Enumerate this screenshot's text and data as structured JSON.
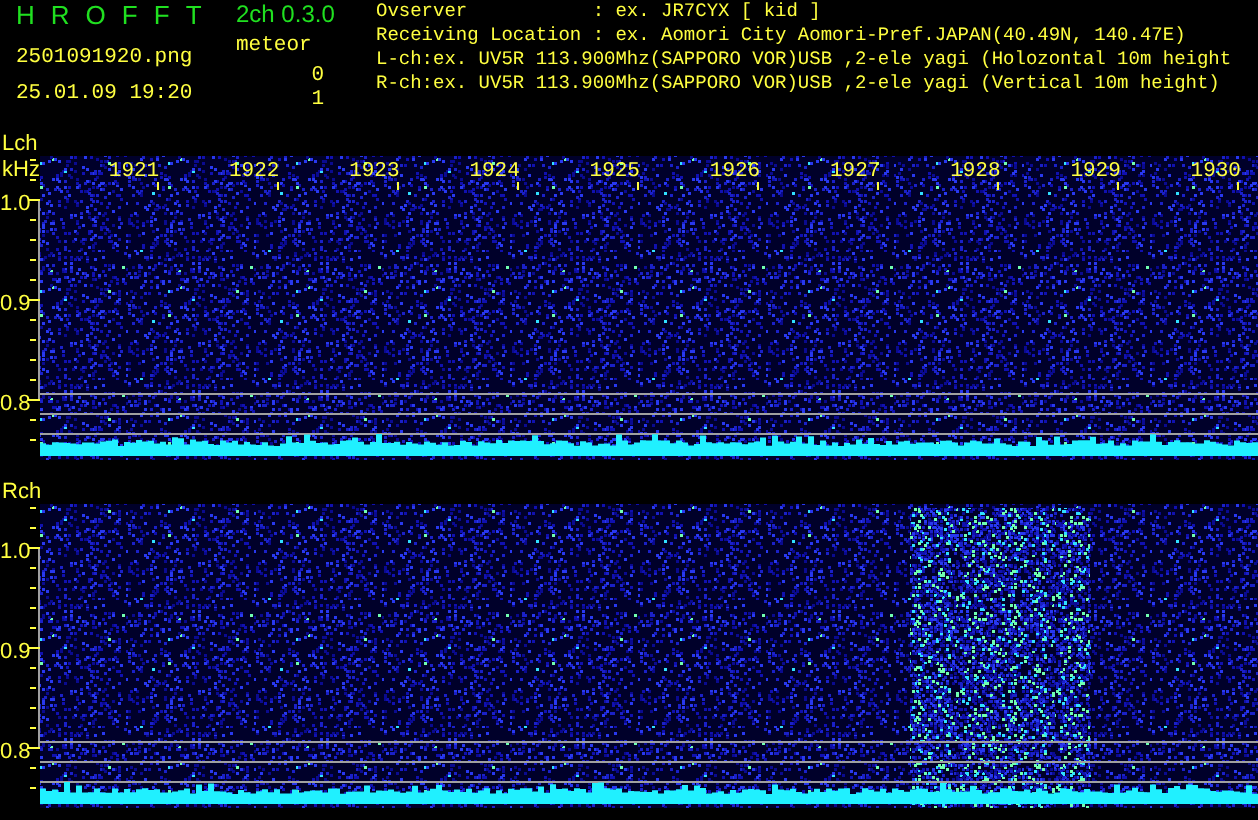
{
  "header": {
    "app_letters": [
      "H",
      "R",
      "O",
      "F",
      "F",
      "T"
    ],
    "version": "2ch 0.3.0",
    "file_name": "2501091920.png",
    "datetime": "25.01.09 19:20",
    "count_label": "meteor",
    "counts": [
      "0",
      "1"
    ],
    "info_lines": [
      "Ovserver           : ex. JR7CYX [ kid ]",
      "Receiving Location : ex. Aomori City Aomori-Pref.JAPAN(40.49N, 140.47E)",
      "L-ch:ex. UV5R 113.900Mhz(SAPPORO VOR)USB ,2-ele yagi (Holozontal 10m height",
      "R-ch:ex. UV5R 113.900Mhz(SAPPORO VOR)USB ,2-ele yagi (Vertical 10m height)"
    ]
  },
  "panels": [
    {
      "label": "Lch",
      "unit": "kHz",
      "time_labels": [
        "1921",
        "1922",
        "1923",
        "1924",
        "1925",
        "1926",
        "1927",
        "1928",
        "1929",
        "1930"
      ],
      "y_labels": [
        "1.0",
        "0.9",
        "0.8"
      ],
      "meteor_burst": false
    },
    {
      "label": "Rch",
      "y_labels": [
        "1.0",
        "0.9",
        "0.8"
      ],
      "meteor_burst": true
    }
  ]
}
